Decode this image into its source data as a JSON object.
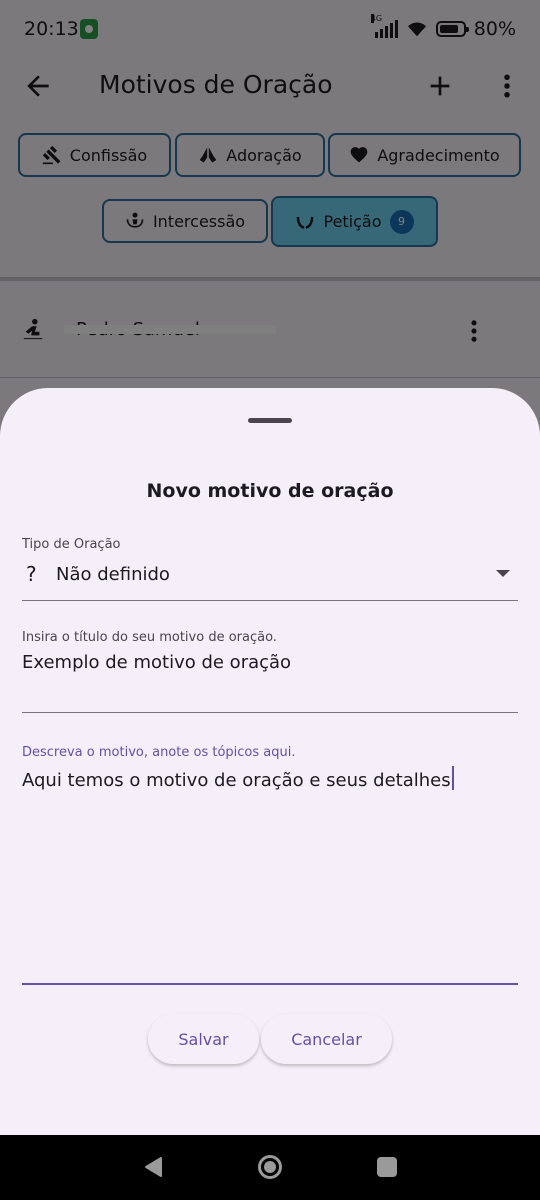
{
  "status_bar": {
    "time": "20:13",
    "network": "4G",
    "battery": "80%"
  },
  "app_bar": {
    "title": "Motivos de Oração",
    "icons": [
      "back-arrow-icon",
      "add-icon",
      "more-vert-icon"
    ]
  },
  "chips": [
    {
      "label": "Confissão",
      "icon": "gavel-icon"
    },
    {
      "label": "Adoração",
      "icon": "praying-hands-icon"
    },
    {
      "label": "Agradecimento",
      "icon": "heart-icon"
    },
    {
      "label": "Intercessão",
      "icon": "hands-person-icon"
    },
    {
      "label": "Petição",
      "icon": "open-hands-icon",
      "selected": true,
      "badge": "9"
    }
  ],
  "list": {
    "items": [
      {
        "title": "Pedro Samuel",
        "icon": "kneeling-person-icon"
      }
    ]
  },
  "sheet": {
    "title": "Novo motivo de oração",
    "type_field": {
      "label": "Tipo de Oração",
      "icon": "?",
      "value": "Não definido"
    },
    "title_field": {
      "label": "Insira o título do seu motivo de oração.",
      "value": "Exemplo de motivo de oração"
    },
    "desc_field": {
      "label": "Descreva o motivo, anote os tópicos aqui.",
      "value": "Aqui temos o motivo de oração e seus detalhes"
    },
    "buttons": {
      "save": "Salvar",
      "cancel": "Cancelar"
    }
  },
  "colors": {
    "accent": "#6750a4",
    "chip_border": "#2d6f9d",
    "chip_selected": "#6ed0f1",
    "badge": "#1b6fb4",
    "sheet_bg": "#f4eff8"
  }
}
